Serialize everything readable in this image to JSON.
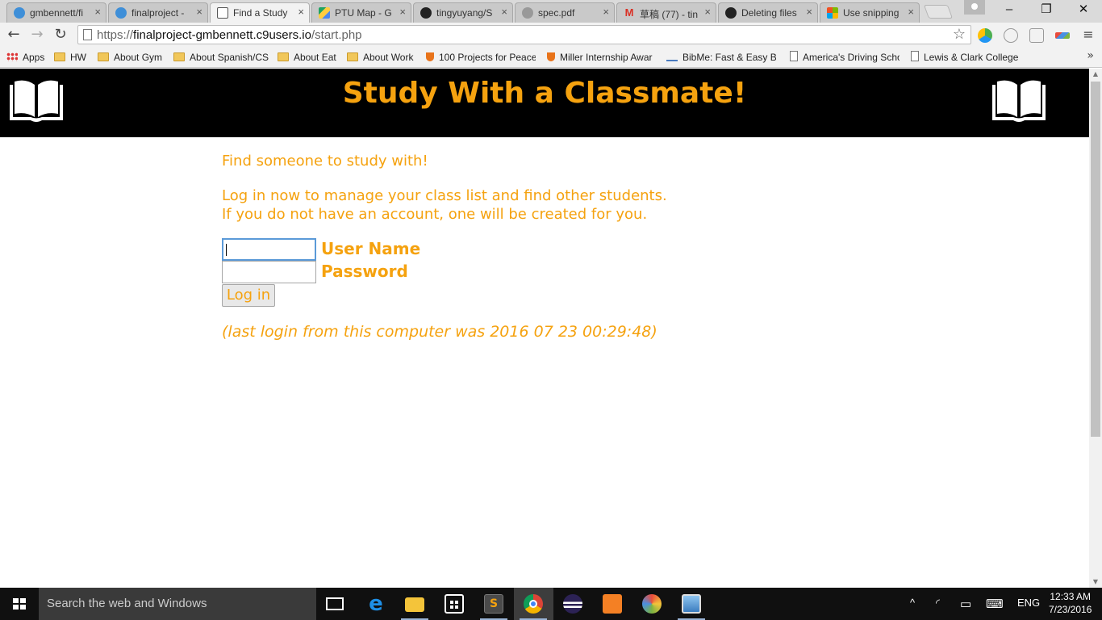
{
  "browser": {
    "tabs": [
      {
        "label": "gmbennett/fi",
        "icon": "cloud9-icon",
        "color": "#3f8fd8"
      },
      {
        "label": "finalproject -",
        "icon": "cloud9-icon",
        "color": "#3f8fd8"
      },
      {
        "label": "Find a Study",
        "icon": "book-icon",
        "color": "#555555"
      },
      {
        "label": "PTU Map - G",
        "icon": "google-drive-icon",
        "color": "#1ea362"
      },
      {
        "label": "tingyuyang/S",
        "icon": "github-icon",
        "color": "#222222"
      },
      {
        "label": "spec.pdf",
        "icon": "pdf-icon",
        "color": "#888888"
      },
      {
        "label": "草稿 (77) - tin",
        "icon": "gmail-icon",
        "color": "#d93025"
      },
      {
        "label": "Deleting files",
        "icon": "github-icon",
        "color": "#222222"
      },
      {
        "label": "Use snipping",
        "icon": "microsoft-icon",
        "color": "#f25022"
      }
    ],
    "url_scheme": "https://",
    "url_domain": "finalproject-gmbennett.c9users.io",
    "url_path": "/start.php",
    "bookmarks": [
      {
        "label": "Apps",
        "type": "apps"
      },
      {
        "label": "HW",
        "type": "folder"
      },
      {
        "label": "About Gym",
        "type": "folder"
      },
      {
        "label": "About Spanish/CS",
        "type": "folder"
      },
      {
        "label": "About Eat",
        "type": "folder"
      },
      {
        "label": "About Work",
        "type": "folder"
      },
      {
        "label": "100 Projects for Peace",
        "type": "site"
      },
      {
        "label": "Miller Internship Awar",
        "type": "site"
      },
      {
        "label": "BibMe: Fast & Easy Bib",
        "type": "site"
      },
      {
        "label": "America's Driving Scho",
        "type": "page"
      },
      {
        "label": "Lewis & Clark College",
        "type": "page"
      }
    ],
    "bookmarks_more": "»"
  },
  "page": {
    "title": "Study With a Classmate!",
    "intro": "Find someone to study with!",
    "instructions_line1": "Log in now to manage your class list and find other students.",
    "instructions_line2": "If you do not have an account, one will be created for you.",
    "username_label": "User Name",
    "password_label": "Password",
    "username_value": "",
    "password_value": "",
    "login_button": "Log in",
    "last_login": "(last login from this computer was 2016 07 23 00:29:48)",
    "accent_color": "#f5a20f",
    "header_bg": "#000000"
  },
  "taskbar": {
    "search_placeholder": "Search the web and Windows",
    "language": "ENG",
    "time": "12:33 AM",
    "date": "7/23/2016"
  }
}
